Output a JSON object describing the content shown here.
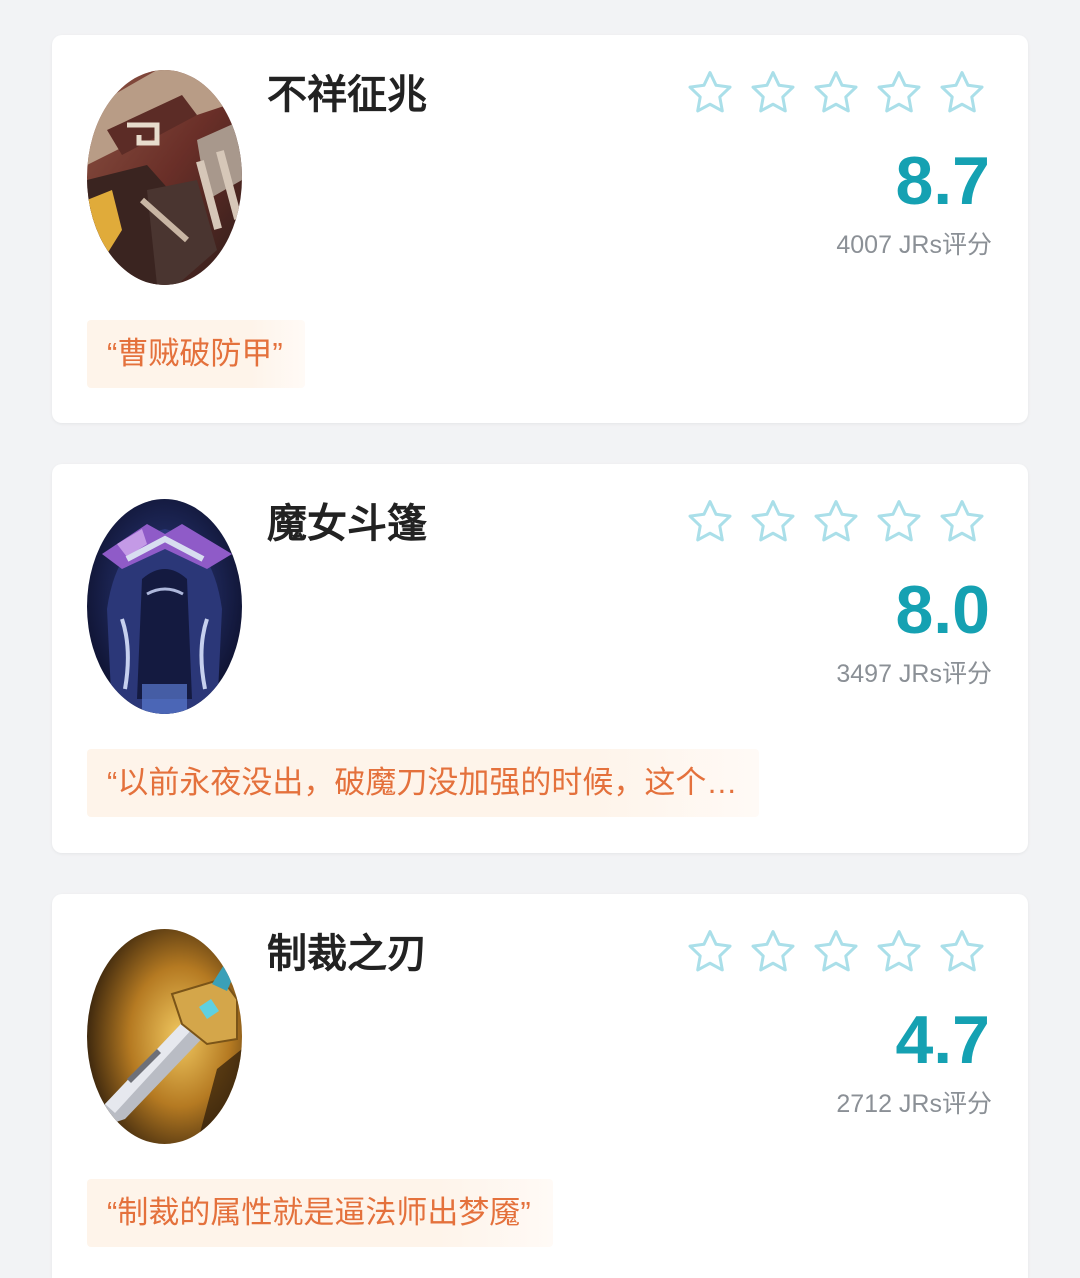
{
  "theme": {
    "accent": "#15a1b2",
    "star_outline": "#aadfe9",
    "quote_text": "#e4713c",
    "quote_bg": "#fef4ea",
    "title": "#222222",
    "count": "#8b9096",
    "page_bg": "#f2f3f5"
  },
  "rating_scale": 5,
  "items": [
    {
      "name": "不祥征兆",
      "avatar_icon": "armor-icon",
      "user_rating": 0,
      "score": "8.7",
      "rating_count": "4007 JRs评分",
      "quote": "“曹贼破防甲”"
    },
    {
      "name": "魔女斗篷",
      "avatar_icon": "cloak-icon",
      "user_rating": 0,
      "score": "8.0",
      "rating_count": "3497 JRs评分",
      "quote": "“以前永夜没出，破魔刀没加强的时候，这个…"
    },
    {
      "name": "制裁之刃",
      "avatar_icon": "sword-icon",
      "user_rating": 0,
      "score": "4.7",
      "rating_count": "2712 JRs评分",
      "quote": "“制裁的属性就是逼法师出梦魇”"
    }
  ]
}
